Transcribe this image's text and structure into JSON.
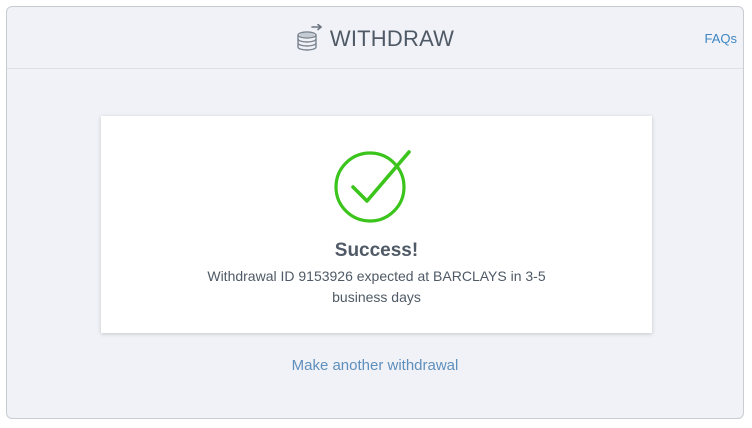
{
  "header": {
    "title": "WITHDRAW",
    "icon": "coins-arrow-icon",
    "faqs_label": "FAQs"
  },
  "result": {
    "status_icon": "check-circle-icon",
    "title": "Success!",
    "message": "Withdrawal ID 9153926 expected at BARCLAYS in 3-5 business days"
  },
  "actions": {
    "another_label": "Make another withdrawal"
  },
  "colors": {
    "panel_bg": "#f0f2f7",
    "success_green": "#3bc41c",
    "link_blue": "#3f86c2",
    "text": "#4f5a66"
  }
}
